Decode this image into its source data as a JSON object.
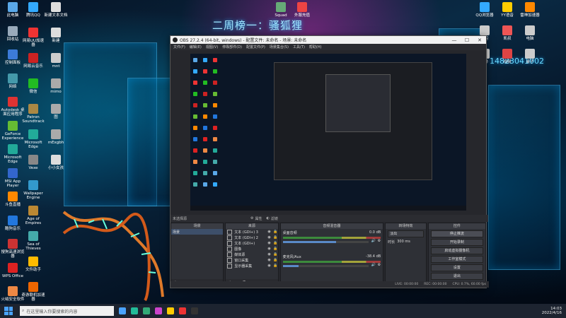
{
  "desktop": {
    "banner_title": "二周榜一：骚狐狸",
    "banner_id": "14823041002",
    "icons_left": [
      {
        "label": "此电脑",
        "color": "#5aa8e8"
      },
      {
        "label": "回收站",
        "color": "#9ab"
      },
      {
        "label": "控制面板",
        "color": "#3c7bd8"
      },
      {
        "label": "网络",
        "color": "#49a"
      },
      {
        "label": "Autodesk 桌面应用程序",
        "color": "#d33"
      },
      {
        "label": "GeForce Experience",
        "color": "#6b3"
      },
      {
        "label": "Microsoft Edge",
        "color": "#2a9"
      },
      {
        "label": "MSI App Player",
        "color": "#36c"
      },
      {
        "label": "斗鱼直播",
        "color": "#f80"
      },
      {
        "label": "酷狗音乐",
        "color": "#27d"
      },
      {
        "label": "搜狗高速浏览器",
        "color": "#c33"
      },
      {
        "label": "WPS Office",
        "color": "#d22"
      },
      {
        "label": "火绒安全软件",
        "color": "#e84"
      }
    ],
    "icons_col2": [
      {
        "label": "腾讯QQ",
        "color": "#3af"
      },
      {
        "label": "网易UU加速器",
        "color": "#e33"
      },
      {
        "label": "网易云音乐",
        "color": "#c22"
      },
      {
        "label": "微信",
        "color": "#2b2"
      },
      {
        "label": "Patron Soundtrack",
        "color": "#a84"
      },
      {
        "label": "Microsoft Edge",
        "color": "#2a9"
      },
      {
        "label": "Vexe",
        "color": "#888"
      },
      {
        "label": "Wallpaper Engine",
        "color": "#39c"
      },
      {
        "label": "Age of Empires",
        "color": "#b83"
      },
      {
        "label": "Sea of Thieves",
        "color": "#4aa"
      },
      {
        "label": "文件助手",
        "color": "#fb0"
      },
      {
        "label": "奇游联机加速器",
        "color": "#e60"
      }
    ],
    "icons_col3": [
      {
        "label": "新建文本文档",
        "color": "#ddd"
      },
      {
        "label": "新建",
        "color": "#ddd"
      },
      {
        "label": "mnt",
        "color": "#ccc"
      },
      {
        "label": "mimo",
        "color": "#aaa"
      },
      {
        "label": "图",
        "color": "#aaa"
      },
      {
        "label": "mExgbh",
        "color": "#aaa"
      },
      {
        "label": "小小女孩",
        "color": "#ddd"
      }
    ],
    "icons_top": [
      {
        "label": "Squad",
        "color": "#6a7"
      },
      {
        "label": "外服充值",
        "color": "#e44"
      }
    ],
    "icons_right": [
      {
        "label": "QQ浏览器",
        "color": "#3af"
      },
      {
        "label": "YY语音",
        "color": "#fc0"
      },
      {
        "label": "雷神加速器",
        "color": "#f80"
      },
      {
        "label": "学习",
        "color": "#ccc"
      },
      {
        "label": "凯叔",
        "color": "#e55"
      },
      {
        "label": "电脑",
        "color": "#ccc"
      },
      {
        "label": "文件",
        "color": "#ddd"
      },
      {
        "label": "视频",
        "color": "#d44"
      },
      {
        "label": "桌子",
        "color": "#ccc"
      }
    ]
  },
  "obs": {
    "title": "OBS 27.2.4 (64-bit, windows) - 配置文件: 未命名 - 场景: 未命名",
    "menu": [
      "文件(F)",
      "编辑(E)",
      "视图(V)",
      "停靠部件(D)",
      "配置文件(P)",
      "场景集合(S)",
      "工具(T)",
      "帮助(H)"
    ],
    "scene_bar_label": "未选择源",
    "properties_label": "属性",
    "filters_label": "滤镜",
    "docks": {
      "scenes": {
        "title": "场景",
        "items": [
          "场景"
        ]
      },
      "sources": {
        "title": "来源",
        "items": [
          {
            "label": "文本 (GDI+) 3",
            "icon": "text"
          },
          {
            "label": "文本 (GDI+) 2",
            "icon": "text"
          },
          {
            "label": "文本 (GDI+)",
            "icon": "text"
          },
          {
            "label": "图像",
            "icon": "image"
          },
          {
            "label": "媒体源",
            "icon": "media"
          },
          {
            "label": "窗口采集",
            "icon": "window"
          },
          {
            "label": "显示器采集",
            "icon": "display"
          }
        ]
      },
      "mixer": {
        "title": "音频混音器",
        "channels": [
          {
            "name": "桌面音频",
            "db": "0.0 dB",
            "level": 0.62
          },
          {
            "name": "麦克风/Aux",
            "db": "-38.4 dB",
            "level": 0.18
          }
        ]
      },
      "transitions": {
        "title": "转场特效",
        "type": "淡出",
        "duration_label": "时长",
        "duration": "300 ms"
      },
      "controls": {
        "title": "控件",
        "buttons": [
          "停止推流",
          "开始录制",
          "启动虚拟摄像机",
          "工作室模式",
          "设置",
          "退出"
        ]
      }
    },
    "status": {
      "live": "LIVE: 00:00:00",
      "rec": "REC: 00:00:00",
      "cpu": "CPU: 0.7%, 60.00 fps"
    }
  },
  "taskbar": {
    "search_placeholder": "在这里输入你要搜索的内容",
    "apps": [
      {
        "color": "#4aa3ff"
      },
      {
        "color": "#2b9"
      },
      {
        "color": "#3a7"
      },
      {
        "color": "#c4c"
      },
      {
        "color": "#fc0"
      },
      {
        "color": "#e33"
      },
      {
        "color": "#333"
      }
    ],
    "time": "14:03",
    "date": "2022/4/16"
  }
}
